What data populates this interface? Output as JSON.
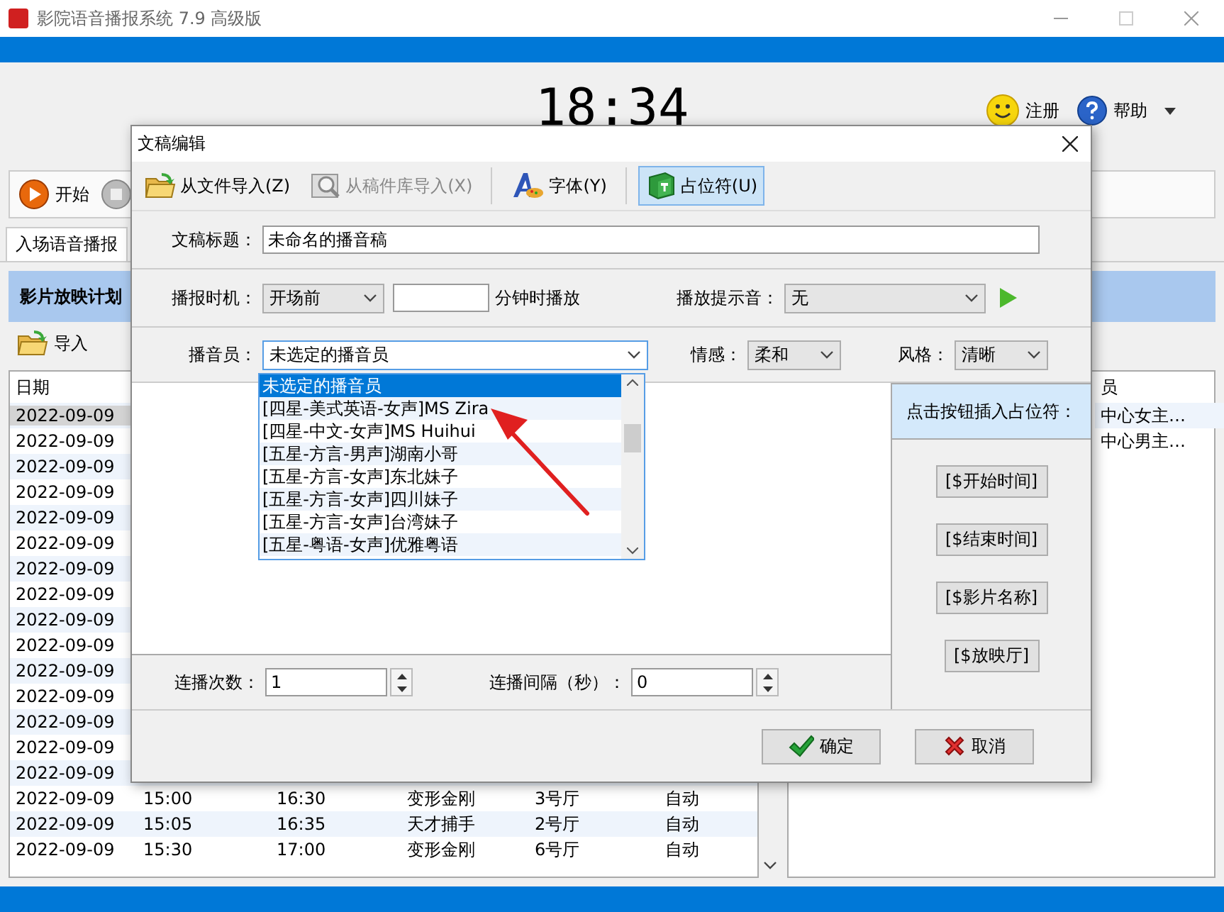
{
  "window": {
    "title": "影院语音播报系统 7.9 高级版"
  },
  "clock": "18:34",
  "header_links": [
    {
      "label": "注册",
      "kind": "smiley"
    },
    {
      "label": "帮助",
      "kind": "help"
    }
  ],
  "toolbar": [
    {
      "label": "开始",
      "kind": "play"
    },
    {
      "kind": "stop"
    }
  ],
  "tabs": [
    {
      "label": "入场语音播报",
      "selected": true
    }
  ],
  "section_title": "影片放映计划",
  "sub_toolbar": [
    {
      "label": "导入",
      "kind": "folder"
    }
  ],
  "schedule": {
    "columns": [
      "日期"
    ],
    "rows": [
      {
        "date": "2022-09-09",
        "selected": true
      },
      {
        "date": "2022-09-09",
        "selected": false
      },
      {
        "date": "2022-09-09",
        "selected": false
      },
      {
        "date": "2022-09-09",
        "selected": false
      },
      {
        "date": "2022-09-09",
        "selected": false
      },
      {
        "date": "2022-09-09",
        "selected": false
      },
      {
        "date": "2022-09-09",
        "selected": false
      },
      {
        "date": "2022-09-09",
        "selected": false
      },
      {
        "date": "2022-09-09",
        "selected": false
      },
      {
        "date": "2022-09-09",
        "selected": false
      },
      {
        "date": "2022-09-09",
        "selected": false
      },
      {
        "date": "2022-09-09",
        "selected": false
      },
      {
        "date": "2022-09-09",
        "selected": false
      },
      {
        "date": "2022-09-09",
        "selected": false
      },
      {
        "date": "2022-09-09",
        "selected": false
      },
      {
        "date": "2022-09-09",
        "start": "15:00",
        "end": "16:30",
        "film": "变形金刚",
        "hall": "3号厅",
        "mode": "自动",
        "selected": false
      },
      {
        "date": "2022-09-09",
        "start": "15:05",
        "end": "16:35",
        "film": "天才捕手",
        "hall": "2号厅",
        "mode": "自动",
        "selected": false
      },
      {
        "date": "2022-09-09",
        "start": "15:30",
        "end": "17:00",
        "film": "变形金刚",
        "hall": "6号厅",
        "mode": "自动",
        "selected": false
      }
    ]
  },
  "announcers": {
    "column_1": "员",
    "rows": [
      "中心女主…",
      "中心男主…"
    ]
  },
  "dialog": {
    "title": "文稿编辑",
    "toolbar": [
      {
        "label": "从文件导入(Z)",
        "kind": "folder",
        "disabled": false,
        "selected": false
      },
      {
        "label": "从稿件库导入(X)",
        "kind": "library",
        "disabled": true,
        "selected": false
      },
      {
        "label": "字体(Y)",
        "kind": "font",
        "disabled": false,
        "selected": false
      },
      {
        "label": "占位符(U)",
        "kind": "book",
        "disabled": false,
        "selected": true
      }
    ],
    "title_label": "文稿标题：",
    "title_value": "未命名的播音稿",
    "timing_label": "播报时机：",
    "timing_value": "开场前",
    "minutes_suffix": "分钟时播放",
    "tone_label": "播放提示音：",
    "tone_value": "无",
    "announcer_label": "播音员：",
    "announcer_value": "未选定的播音员",
    "emotion_label": "情感：",
    "emotion_value": "柔和",
    "style_label": "风格：",
    "style_value": "清晰",
    "announcer_options": [
      {
        "label": "未选定的播音员",
        "selected": true
      },
      {
        "label": "[四星-美式英语-女声]MS Zira",
        "selected": false
      },
      {
        "label": "[四星-中文-女声]MS Huihui",
        "selected": false
      },
      {
        "label": "[五星-方言-男声]湖南小哥",
        "selected": false
      },
      {
        "label": "[五星-方言-女声]东北妹子",
        "selected": false
      },
      {
        "label": "[五星-方言-女声]四川妹子",
        "selected": false
      },
      {
        "label": "[五星-方言-女声]台湾妹子",
        "selected": false
      },
      {
        "label": "[五星-粤语-女声]优雅粤语",
        "selected": false
      }
    ],
    "placeholder_heading": "点击按钮插入占位符：",
    "placeholders": [
      "[$开始时间]",
      "[$结束时间]",
      "[$影片名称]",
      "[$放映厅]"
    ],
    "repeat_label": "连播次数：",
    "repeat_value": "1",
    "interval_label": "连播间隔（秒）：",
    "interval_value": "0",
    "buttons": [
      {
        "label": "确定",
        "kind": "ok"
      },
      {
        "label": "取消",
        "kind": "cancel"
      }
    ]
  }
}
